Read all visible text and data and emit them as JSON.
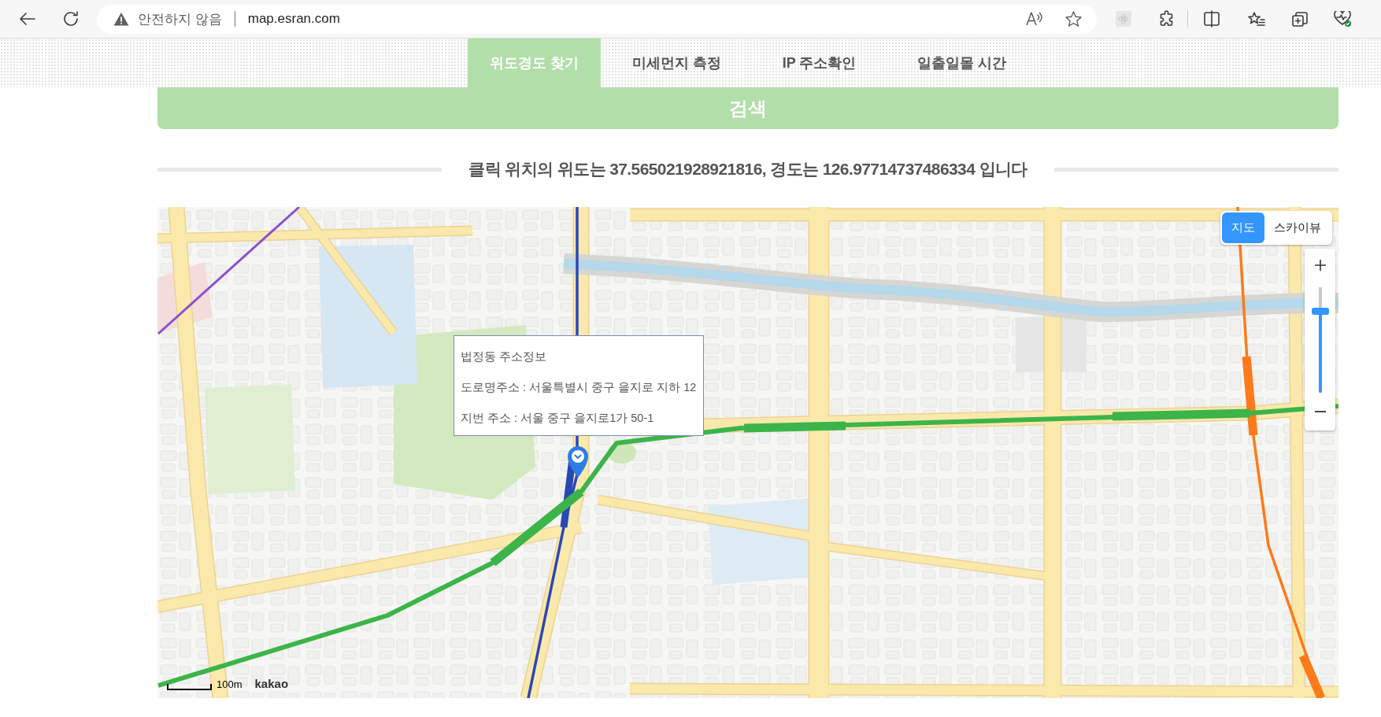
{
  "browser": {
    "security_status": "안전하지 않음",
    "url": "map.esran.com"
  },
  "tabs": [
    {
      "label": "위도경도 찾기",
      "selected": true
    },
    {
      "label": "미세먼지 측정",
      "selected": false
    },
    {
      "label": "IP 주소확인",
      "selected": false
    },
    {
      "label": "일출일몰 시간",
      "selected": false
    }
  ],
  "search": {
    "button": "검색",
    "result": "클릭 위치의 위도는 37.565021928921816, 경도는 126.97714737486334 입니다"
  },
  "map": {
    "info_window": {
      "title": "법정동 주소정보",
      "lines": [
        "도로명주소 : 서울특별시 중구 을지로 지하 12",
        "지번 주소 : 서울 중구 을지로1가 50-1"
      ]
    },
    "map_types": [
      {
        "label": "지도",
        "selected": true
      },
      {
        "label": "스카이뷰",
        "selected": false
      }
    ],
    "zoom": {
      "level": 0.77
    },
    "scale": "100m",
    "attribution": "kakao"
  }
}
